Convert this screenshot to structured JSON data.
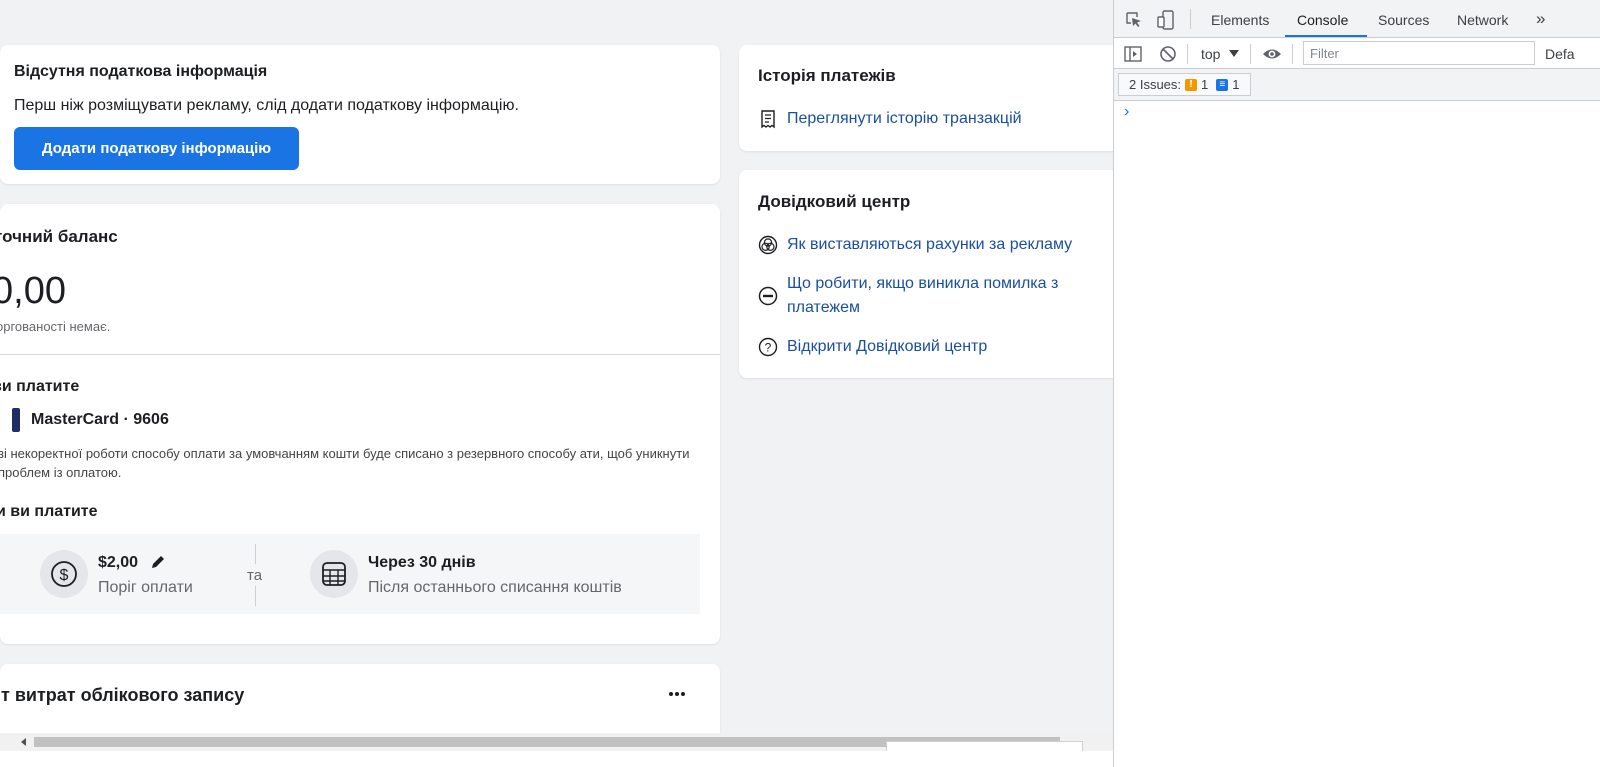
{
  "tax_card": {
    "title": "Відсутня податкова інформація",
    "text": "Перш ніж розміщувати рекламу, слід додати податкову інформацію.",
    "button_label": "Додати податкову інформацію"
  },
  "balance_card": {
    "title": "точний баланс",
    "amount": "0,00",
    "note": "оргованості немає.",
    "payment_method_title": "ви платите",
    "card_name": "MasterCard · 9606",
    "card_note": "зі некоректної роботи способу оплати за умовчанням кошти буде списано з резервного способу ати, щоб уникнути проблем із оплатою.",
    "when_title": "и ви платите",
    "threshold_amount": "$2,00",
    "threshold_label": "Поріг оплати",
    "and_text": "та",
    "schedule_title": "Через 30 днів",
    "schedule_label": "Після останнього списання коштів"
  },
  "spend_card": {
    "title": "іт витрат облікового запису"
  },
  "history_card": {
    "title": "Історія платежів",
    "link": "Переглянути історію транзакцій"
  },
  "help_card": {
    "title": "Довідковий центр",
    "links": [
      "Як виставляються рахунки за рекламу",
      "Що робити, якщо виникла помилка з платежем",
      "Відкрити Довідковий центр"
    ]
  },
  "devtools": {
    "tabs": [
      "Elements",
      "Console",
      "Sources",
      "Network"
    ],
    "more_tabs": "»",
    "active_tab": "Console",
    "context": "top",
    "filter_placeholder": "Filter",
    "levels_label": "Defa",
    "issues_label": "2 Issues:",
    "warning_count": "1",
    "info_count": "1",
    "prompt": "›"
  },
  "icons": {
    "inspect": "inspect-element-icon",
    "device": "device-toolbar-icon",
    "sidebar": "console-sidebar-icon",
    "clear": "clear-console-icon",
    "eye": "live-expression-icon",
    "receipt": "receipt-icon",
    "billing": "billing-circles-icon",
    "error": "minus-circle-icon",
    "help": "question-circle-icon",
    "dollar": "dollar-circle-icon",
    "calendar": "calendar-icon",
    "pencil": "pencil-icon",
    "more": "more-dots-icon"
  },
  "colors": {
    "primary_button": "#1b74e4",
    "link": "#1a4fa0",
    "devtools_accent": "#1a73e8",
    "warning_badge": "#f29900",
    "info_badge": "#1a73e8"
  }
}
